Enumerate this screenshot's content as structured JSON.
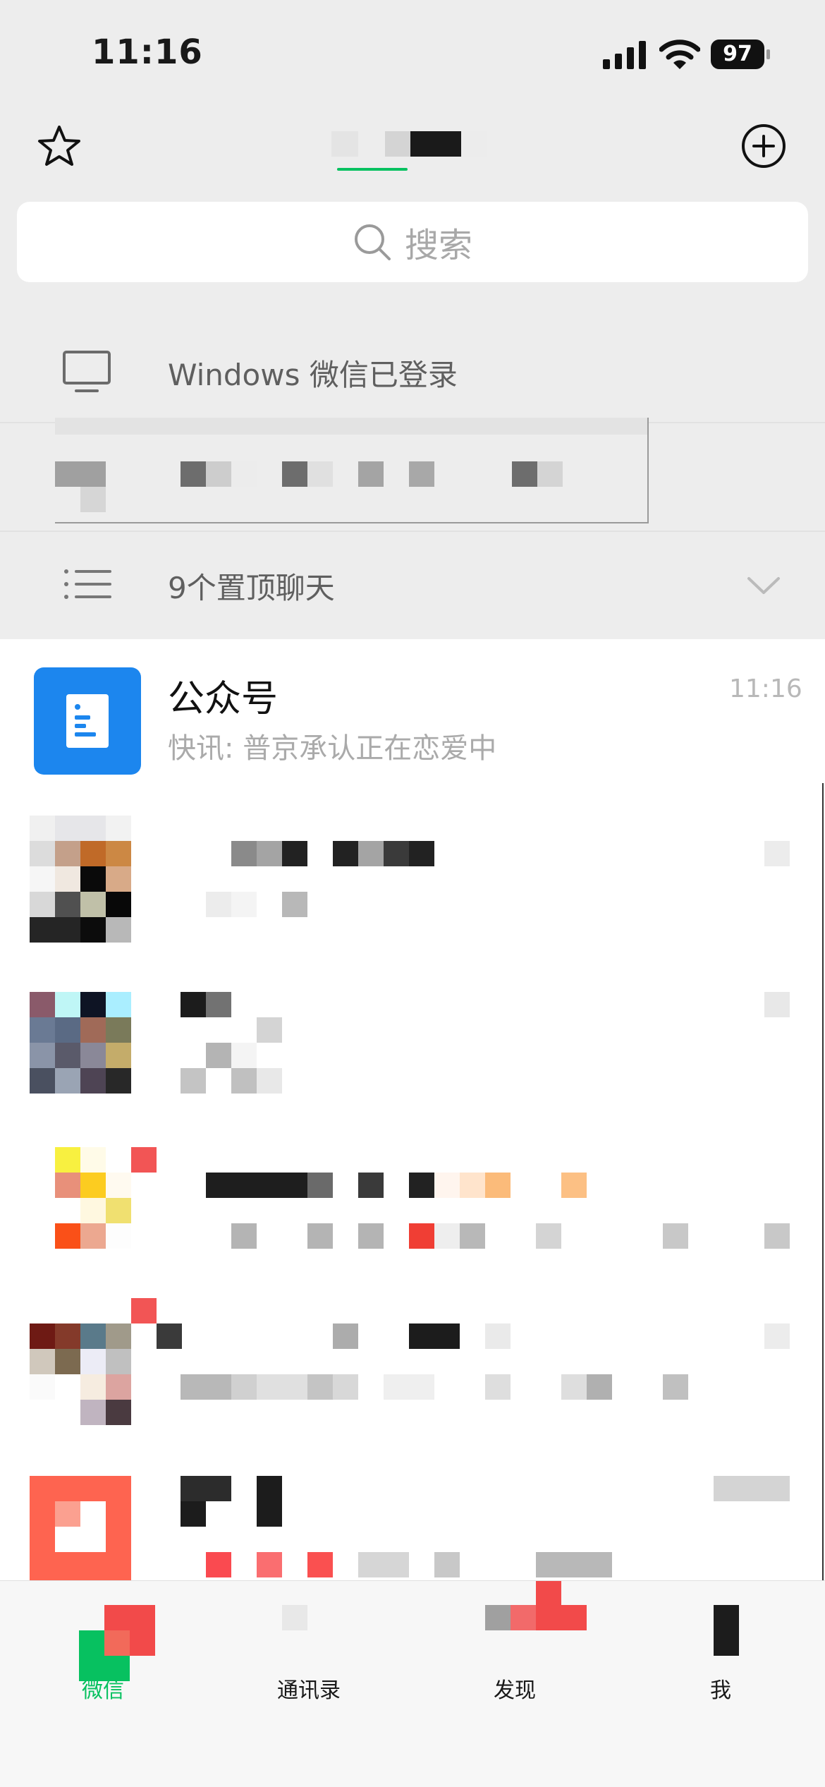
{
  "status_bar": {
    "time": "11:16",
    "battery": "97"
  },
  "search": {
    "placeholder": "搜索"
  },
  "windows_login": {
    "text": "Windows 微信已登录"
  },
  "pinned": {
    "text": "9个置顶聊天"
  },
  "chats": [
    {
      "name": "公众号",
      "preview": "快讯: 普京承认正在恋爱中",
      "time": "11:16"
    }
  ],
  "tabs": [
    {
      "label": "微信"
    },
    {
      "label": "通讯录"
    },
    {
      "label": "发现"
    },
    {
      "label": "我"
    }
  ],
  "colors": {
    "accent": "#07c160",
    "gzh_avatar": "#1c86ee",
    "background": "#ededed"
  }
}
